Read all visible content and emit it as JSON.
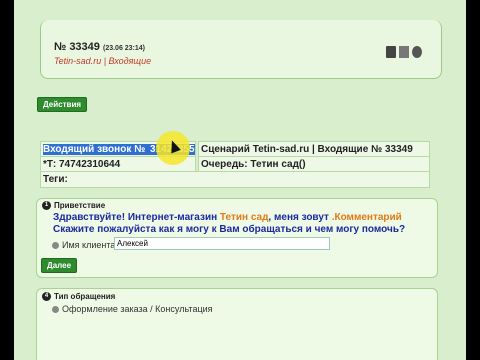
{
  "order": {
    "number": "№ 33349",
    "date": "(23.06 23:14)",
    "source": "Tetin-sad.ru | Входящие"
  },
  "actions": {
    "label": "Действия"
  },
  "info": {
    "incoming_label": "Входящий звонок № ",
    "incoming_number": "31424355",
    "scenario": "Сценарий Tetin-sad.ru | Входящие № 33349",
    "phone": "*Т: 74742310644",
    "queue": "Очередь: Тетин сад()",
    "tags": "Теги:"
  },
  "greeting": {
    "step": "1",
    "title": "Приветствие",
    "line1_a": "Здравствуйте! Интернет-магазин ",
    "line1_shop": "Тетин сад",
    "line1_b": ", меня зовут ",
    "line1_comment": ".Комментарий",
    "line2": "Скажите пожалуйста как я могу к Вам обращаться и чем могу помочь?",
    "client_label": "Имя клиента*",
    "client_value": "Алексей",
    "next_label": "Далее"
  },
  "request_type": {
    "step": "4",
    "title": "Тип обращения",
    "option": "Оформление заказа / Консультация"
  }
}
